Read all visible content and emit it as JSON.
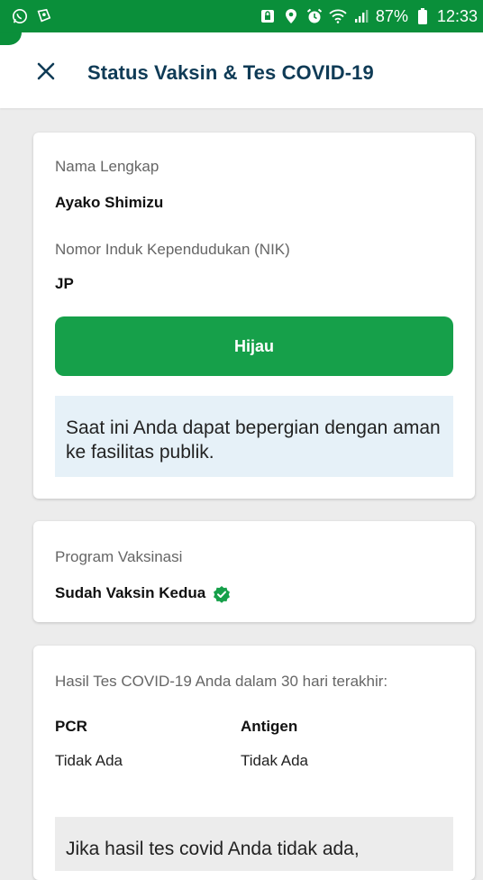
{
  "status_bar": {
    "battery": "87%",
    "time": "12:33",
    "left_icons": [
      "whatsapp-icon",
      "gallery-icon"
    ],
    "right_icons": [
      "vpn-lock-icon",
      "location-icon",
      "alarm-icon",
      "wifi-icon",
      "signal-icon",
      "battery-icon"
    ],
    "color": "#0a8f3a"
  },
  "header": {
    "title": "Status Vaksin & Tes COVID-19",
    "close_icon": "close-icon"
  },
  "identity_card": {
    "name_label": "Nama Lengkap",
    "name_value": "Ayako Shimizu",
    "nik_label": "Nomor Induk Kependudukan (NIK)",
    "nik_value": "JP",
    "status_label": "Hijau",
    "status_color": "#16a04a",
    "message": "Saat ini Anda dapat bepergian dengan aman ke fasilitas publik."
  },
  "vaccination_card": {
    "label": "Program Vaksinasi",
    "value": "Sudah Vaksin Kedua",
    "badge_icon": "verified-check-icon"
  },
  "test_card": {
    "heading": "Hasil Tes COVID-19 Anda dalam 30 hari terakhir:",
    "columns": [
      {
        "title": "PCR",
        "value": "Tidak Ada"
      },
      {
        "title": "Antigen",
        "value": "Tidak Ada"
      }
    ],
    "note": "Jika hasil tes covid Anda tidak ada,"
  }
}
